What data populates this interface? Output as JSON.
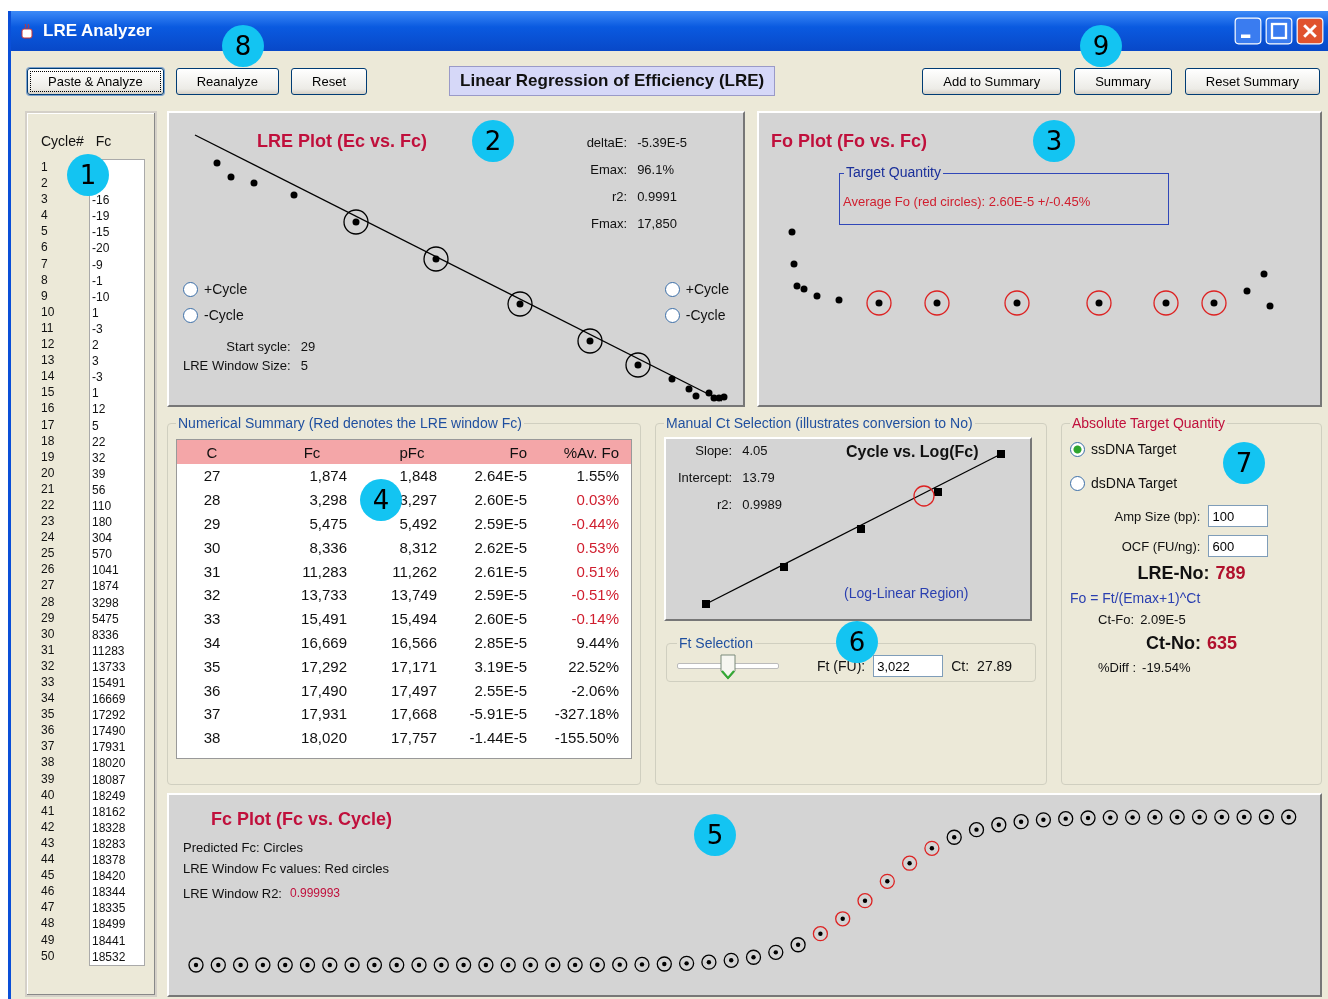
{
  "window": {
    "title": "LRE Analyzer"
  },
  "toolbar": {
    "left_buttons": [
      {
        "label": "Paste & Analyze",
        "focused": true
      },
      {
        "label": "Reanalyze",
        "focused": false
      },
      {
        "label": "Reset",
        "focused": false
      }
    ],
    "heading": "Linear Regression of Efficiency (LRE)",
    "right_buttons": [
      {
        "label": "Add to Summary",
        "focused": false
      },
      {
        "label": "Summary",
        "focused": false
      },
      {
        "label": "Reset Summary",
        "focused": false
      }
    ]
  },
  "cycle_list": {
    "columns": [
      "Cycle#",
      "Fc"
    ],
    "rows": [
      {
        "cycle": "1"
      },
      {
        "cycle": "2"
      },
      {
        "cycle": "3",
        "fc": "-16"
      },
      {
        "cycle": "4",
        "fc": "-19"
      },
      {
        "cycle": "5",
        "fc": "-15"
      },
      {
        "cycle": "6",
        "fc": "-20"
      },
      {
        "cycle": "7",
        "fc": "-9"
      },
      {
        "cycle": "8",
        "fc": "-1"
      },
      {
        "cycle": "9",
        "fc": "-10"
      },
      {
        "cycle": "10",
        "fc": "1"
      },
      {
        "cycle": "11",
        "fc": "-3"
      },
      {
        "cycle": "12",
        "fc": "2"
      },
      {
        "cycle": "13",
        "fc": "3"
      },
      {
        "cycle": "14",
        "fc": "-3"
      },
      {
        "cycle": "15",
        "fc": "1"
      },
      {
        "cycle": "16",
        "fc": "12"
      },
      {
        "cycle": "17",
        "fc": "5"
      },
      {
        "cycle": "18",
        "fc": "22"
      },
      {
        "cycle": "19",
        "fc": "32"
      },
      {
        "cycle": "20",
        "fc": "39"
      },
      {
        "cycle": "21",
        "fc": "56"
      },
      {
        "cycle": "22",
        "fc": "110"
      },
      {
        "cycle": "23",
        "fc": "180"
      },
      {
        "cycle": "24",
        "fc": "304"
      },
      {
        "cycle": "25",
        "fc": "570"
      },
      {
        "cycle": "26",
        "fc": "1041"
      },
      {
        "cycle": "27",
        "fc": "1874"
      },
      {
        "cycle": "28",
        "fc": "3298"
      },
      {
        "cycle": "29",
        "fc": "5475"
      },
      {
        "cycle": "30",
        "fc": "8336"
      },
      {
        "cycle": "31",
        "fc": "11283"
      },
      {
        "cycle": "32",
        "fc": "13733"
      },
      {
        "cycle": "33",
        "fc": "15491"
      },
      {
        "cycle": "34",
        "fc": "16669"
      },
      {
        "cycle": "35",
        "fc": "17292"
      },
      {
        "cycle": "36",
        "fc": "17490"
      },
      {
        "cycle": "37",
        "fc": "17931"
      },
      {
        "cycle": "38",
        "fc": "18020"
      },
      {
        "cycle": "39",
        "fc": "18087"
      },
      {
        "cycle": "40",
        "fc": "18249"
      },
      {
        "cycle": "41",
        "fc": "18162"
      },
      {
        "cycle": "42",
        "fc": "18328"
      },
      {
        "cycle": "43",
        "fc": "18283"
      },
      {
        "cycle": "44",
        "fc": "18378"
      },
      {
        "cycle": "45",
        "fc": "18420"
      },
      {
        "cycle": "46",
        "fc": "18344"
      },
      {
        "cycle": "47",
        "fc": "18335"
      },
      {
        "cycle": "48",
        "fc": "18499"
      },
      {
        "cycle": "49",
        "fc": "18441"
      },
      {
        "cycle": "50",
        "fc": "18532"
      }
    ]
  },
  "lre_plot": {
    "title": "LRE Plot (Ec vs. Fc)",
    "stats": [
      {
        "label": "deltaE:",
        "value": "-5.39E-5"
      },
      {
        "label": "Emax:",
        "value": "96.1%"
      },
      {
        "label": "r2:",
        "value": "0.9991"
      },
      {
        "label": "Fmax:",
        "value": "17,850"
      }
    ],
    "left_radios": [
      {
        "label": "+Cycle",
        "selected": false
      },
      {
        "label": "-Cycle",
        "selected": false
      }
    ],
    "right_radios": [
      {
        "label": "+Cycle",
        "selected": false
      },
      {
        "label": "-Cycle",
        "selected": false
      }
    ],
    "info": [
      {
        "label": "Start sycle:",
        "value": "29"
      },
      {
        "label": "LRE Window Size:",
        "value": "5"
      }
    ]
  },
  "fo_plot": {
    "title": "Fo Plot (Fo vs. Fc)",
    "target_quantity": {
      "legend": "Target Quantity",
      "text": "Average Fo (red circles):  2.60E-5  +/-0.45%"
    }
  },
  "numerical_summary": {
    "legend": "Numerical Summary (Red denotes the LRE window Fc)",
    "columns": [
      "C",
      "Fc",
      "pFc",
      "Fo",
      "%Av. Fo"
    ],
    "rows": [
      {
        "cells": [
          "27",
          "1,874",
          "1,848",
          "2.64E-5",
          "1.55%"
        ],
        "in_window": false
      },
      {
        "cells": [
          "28",
          "3,298",
          "3,297",
          "2.60E-5",
          "0.03%"
        ],
        "in_window": true
      },
      {
        "cells": [
          "29",
          "5,475",
          "5,492",
          "2.59E-5",
          "-0.44%"
        ],
        "in_window": true
      },
      {
        "cells": [
          "30",
          "8,336",
          "8,312",
          "2.62E-5",
          "0.53%"
        ],
        "in_window": true
      },
      {
        "cells": [
          "31",
          "11,283",
          "11,262",
          "2.61E-5",
          "0.51%"
        ],
        "in_window": true
      },
      {
        "cells": [
          "32",
          "13,733",
          "13,749",
          "2.59E-5",
          "-0.51%"
        ],
        "in_window": true
      },
      {
        "cells": [
          "33",
          "15,491",
          "15,494",
          "2.60E-5",
          "-0.14%"
        ],
        "in_window": true
      },
      {
        "cells": [
          "34",
          "16,669",
          "16,566",
          "2.85E-5",
          "9.44%"
        ],
        "in_window": false
      },
      {
        "cells": [
          "35",
          "17,292",
          "17,171",
          "3.19E-5",
          "22.52%"
        ],
        "in_window": false
      },
      {
        "cells": [
          "36",
          "17,490",
          "17,497",
          "2.55E-5",
          "-2.06%"
        ],
        "in_window": false
      },
      {
        "cells": [
          "37",
          "17,931",
          "17,668",
          "-5.91E-5",
          "-327.18%"
        ],
        "in_window": false
      },
      {
        "cells": [
          "38",
          "18,020",
          "17,757",
          "-1.44E-5",
          "-155.50%"
        ],
        "in_window": false
      }
    ]
  },
  "manual_ct": {
    "legend": "Manual Ct Selection (illustrates conversion to No)",
    "chart": {
      "title": "Cycle vs. Log(Fc)",
      "stats": [
        {
          "label": "Slope:",
          "value": "4.05"
        },
        {
          "label": "Intercept:",
          "value": "13.79"
        },
        {
          "label": "r2:",
          "value": "0.9989"
        }
      ],
      "region_label": "(Log-Linear Region)"
    },
    "ft_selection": {
      "legend": "Ft Selection",
      "level": 0.5,
      "ft_label": "Ft (FU):",
      "ft_value": "3,022",
      "ct_label": "Ct:",
      "ct_value": "27.89"
    }
  },
  "absolute_target": {
    "legend": "Absolute Target Quantity",
    "radios": [
      {
        "label": "ssDNA Target",
        "selected": true
      },
      {
        "label": "dsDNA Target",
        "selected": false
      }
    ],
    "fields": [
      {
        "label": "Amp Size (bp):",
        "value": "100"
      },
      {
        "label": "OCF (FU/ng):",
        "value": "600"
      }
    ],
    "lre_no": {
      "label": "LRE-No:",
      "value": "789"
    },
    "formula": "Fo =  Ft/(Emax+1)^Ct",
    "ct_fo": {
      "label": "Ct-Fo:",
      "value": "2.09E-5"
    },
    "ct_no": {
      "label": "Ct-No:",
      "value": "635"
    },
    "diff": {
      "label": "%Diff :",
      "value": "-19.54%"
    }
  },
  "fc_plot": {
    "title": "Fc Plot (Fc vs. Cycle)",
    "legend_lines": [
      "Predicted Fc: Circles",
      "LRE Window Fc values: Red circles"
    ],
    "r2": {
      "label": "LRE Window R2:",
      "value": "0.999993"
    }
  },
  "callouts": [
    "1",
    "2",
    "3",
    "4",
    "5",
    "6",
    "7",
    "8",
    "9"
  ]
}
